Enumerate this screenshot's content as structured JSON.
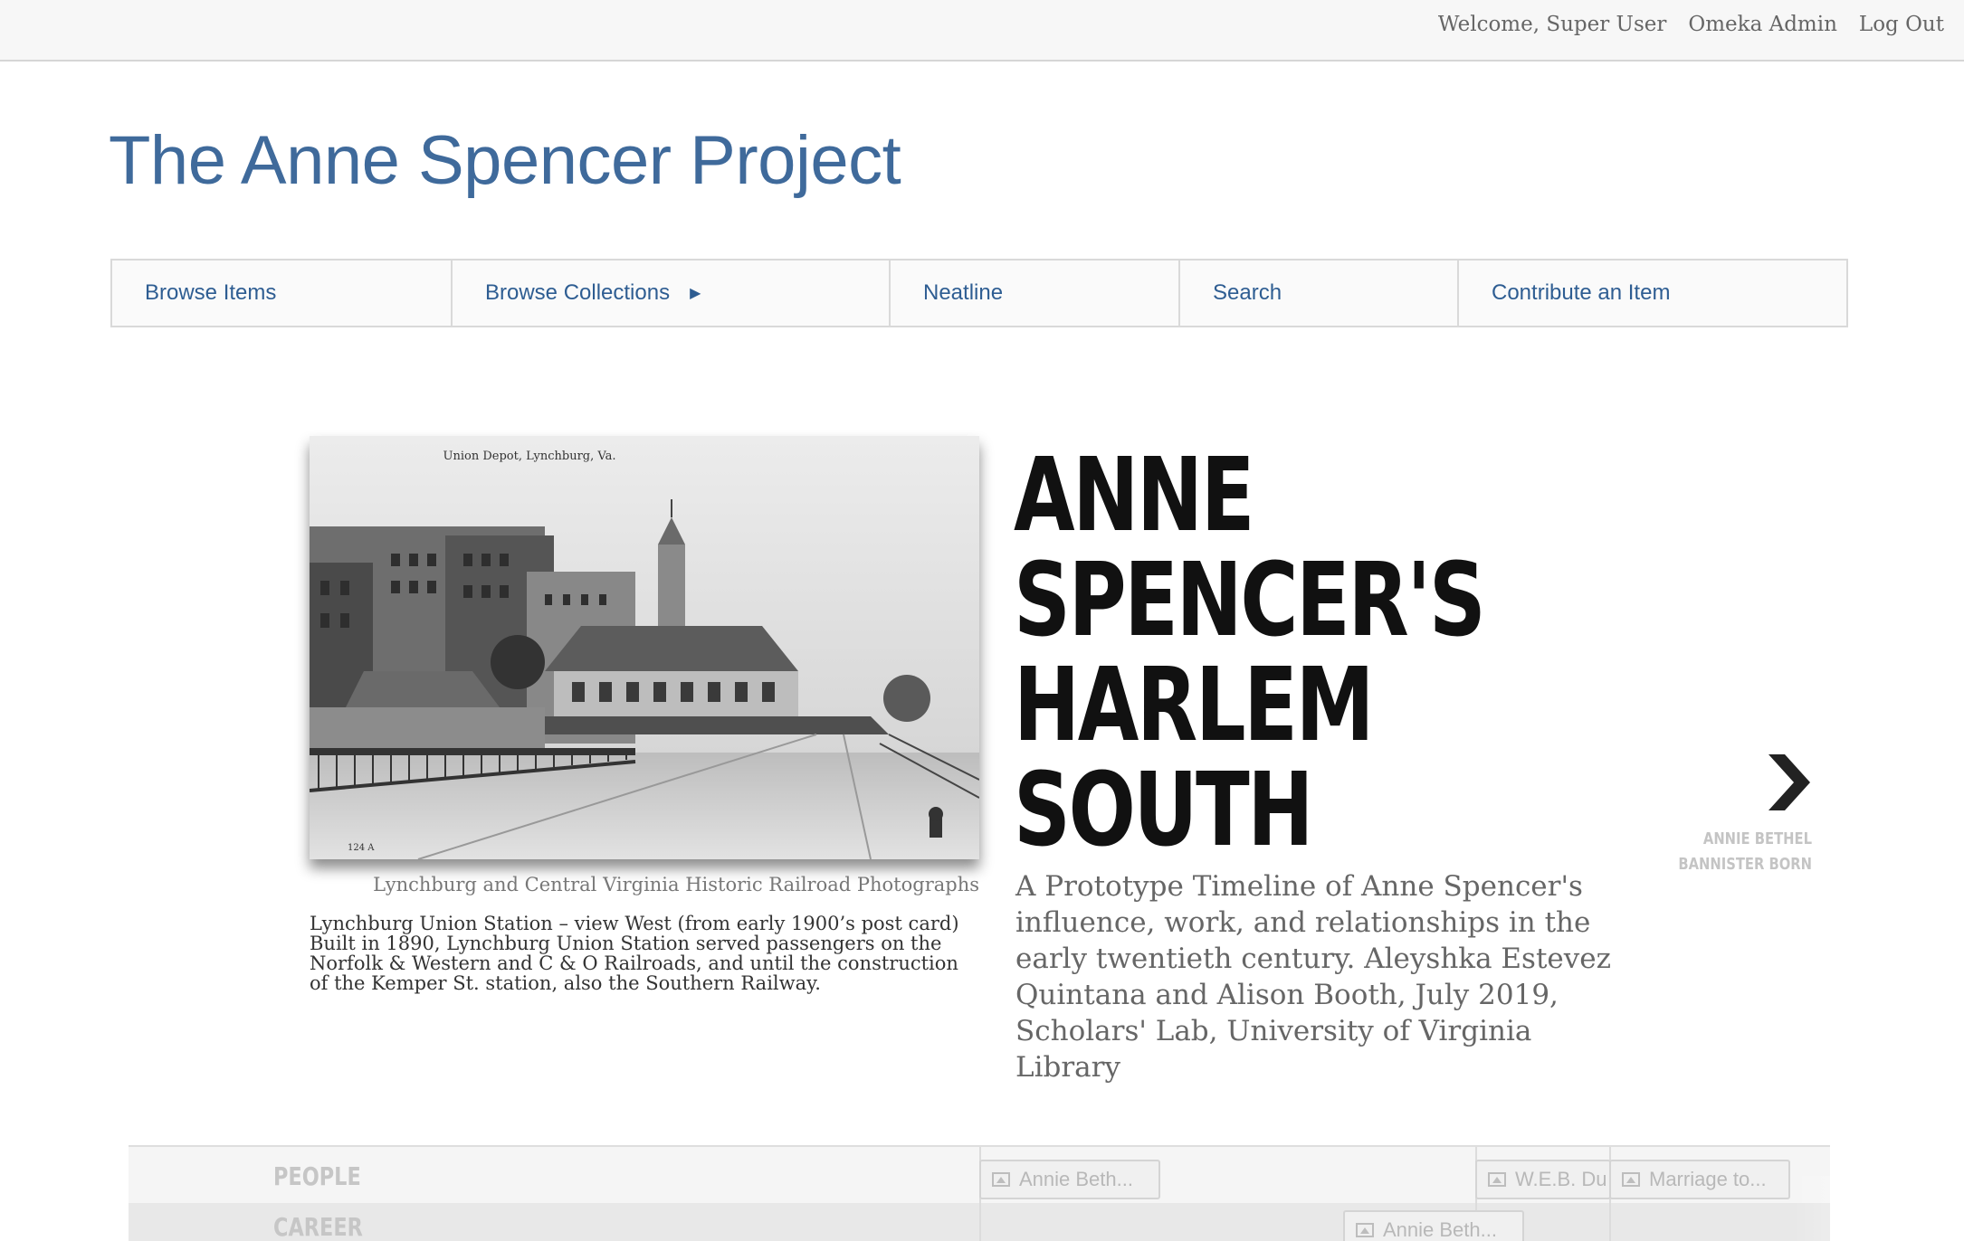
{
  "admin_bar": {
    "welcome": "Welcome, Super User",
    "admin_link": "Omeka Admin",
    "logout": "Log Out"
  },
  "site": {
    "title": "The Anne Spencer Project"
  },
  "nav": {
    "items": [
      {
        "label": "Browse Items"
      },
      {
        "label": "Browse Collections",
        "has_submenu": true
      },
      {
        "label": "Neatline"
      },
      {
        "label": "Search"
      },
      {
        "label": "Contribute an Item"
      }
    ]
  },
  "slide": {
    "photo_inscription": "Union Depot, Lynchburg, Va.",
    "photo_number": "124 A",
    "credit": "Lynchburg and Central Virginia Historic Railroad Photographs",
    "caption": "Lynchburg Union Station – view West (from early 1900’s post card) Built in 1890, Lynchburg Union Station served passengers on the Norfolk & Western and C & O Railroads, and until the construction of the Kemper St. station, also the Southern Railway.",
    "headline_lines": [
      "ANNE",
      "SPENCER'S",
      "HARLEM",
      "SOUTH"
    ],
    "subtitle": "A Prototype Timeline of Anne Spencer's influence, work, and relationships in the early twentieth century. Aleyshka Estevez Quintana and Alison Booth, July 2019, Scholars' Lab, University of Virginia Library",
    "next_label_lines": [
      "ANNIE BETHEL",
      "BANNISTER BORN"
    ],
    "next_icon": "chevron-right-icon"
  },
  "timeline": {
    "rows": [
      {
        "label": "PEOPLE"
      },
      {
        "label": "CAREER"
      }
    ],
    "items": [
      {
        "label": "Annie Beth..."
      },
      {
        "label": "W.E.B. Du"
      },
      {
        "label": "Marriage to..."
      },
      {
        "label": "Annie Beth..."
      }
    ]
  }
}
